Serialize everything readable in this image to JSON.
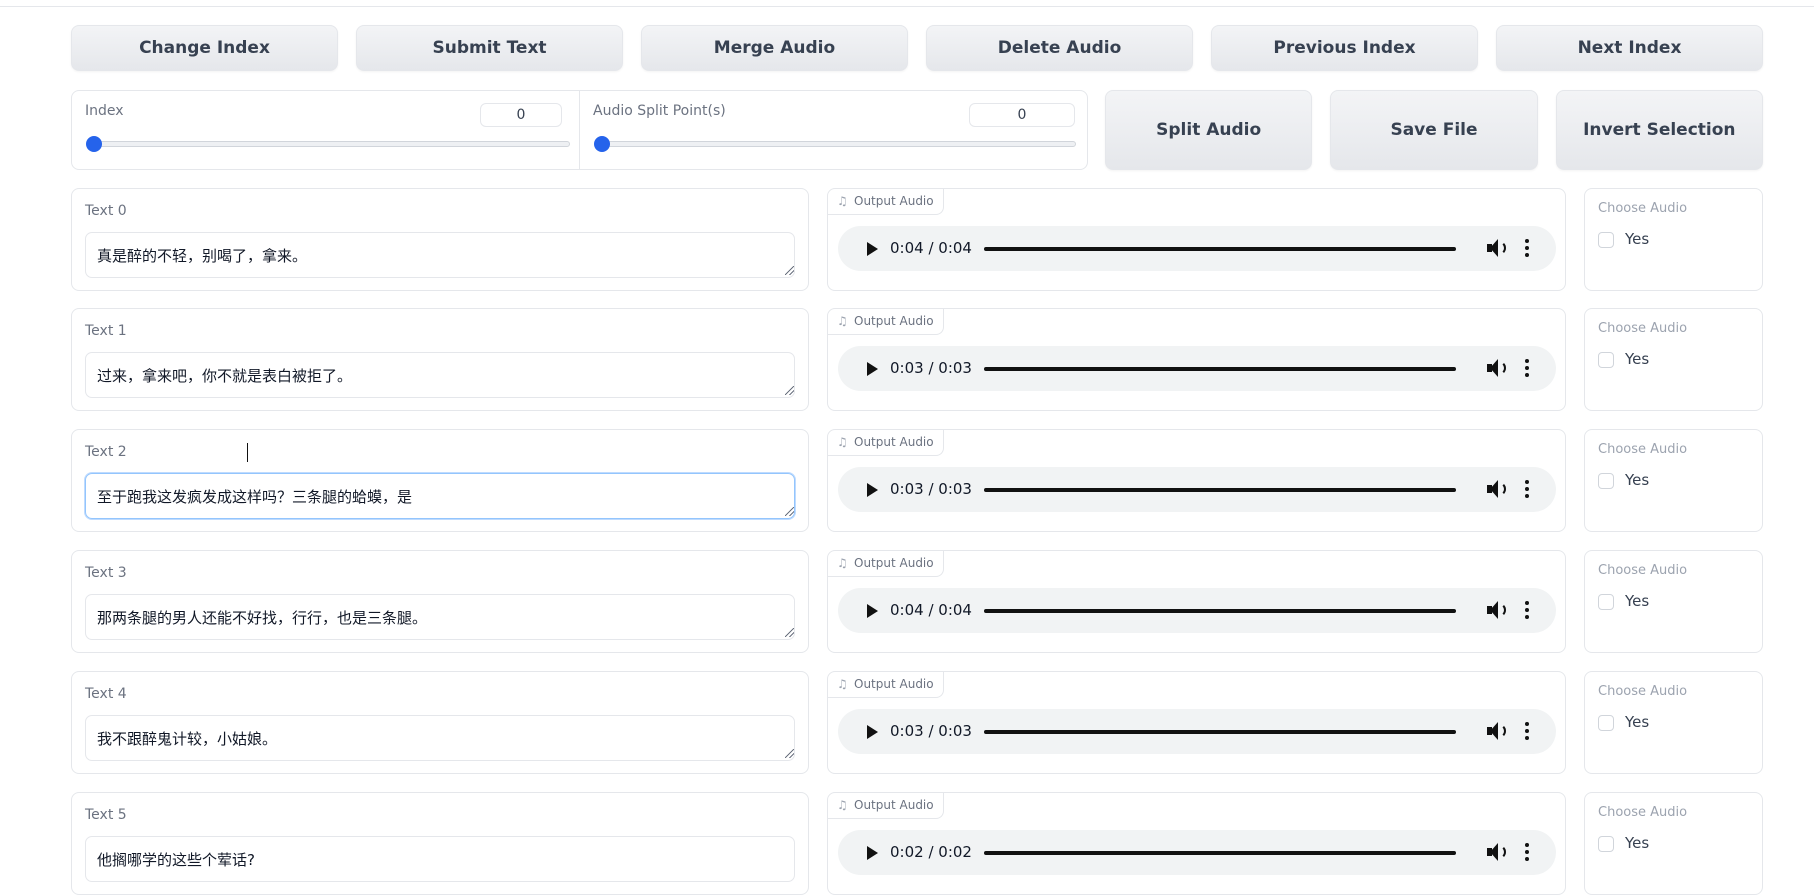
{
  "toolbar": {
    "buttons": [
      "Change Index",
      "Submit Text",
      "Merge Audio",
      "Delete Audio",
      "Previous Index",
      "Next Index"
    ]
  },
  "sliders": {
    "index": {
      "label": "Index",
      "value": "0"
    },
    "split": {
      "label": "Audio Split Point(s)",
      "value": "0"
    }
  },
  "actions": [
    "Split Audio",
    "Save File",
    "Invert Selection"
  ],
  "rows": [
    {
      "label": "Text 0",
      "text": "真是醉的不轻，别喝了，拿来。",
      "audio_label": "Output Audio",
      "time": "0:04 / 0:04",
      "choose_label": "Choose Audio",
      "checkbox_label": "Yes"
    },
    {
      "label": "Text 1",
      "text": "过来，拿来吧，你不就是表白被拒了。",
      "audio_label": "Output Audio",
      "time": "0:03 / 0:03",
      "choose_label": "Choose Audio",
      "checkbox_label": "Yes"
    },
    {
      "label": "Text 2",
      "text": "至于跑我这发疯发成这样吗？三条腿的蛤蟆，是",
      "audio_label": "Output Audio",
      "time": "0:03 / 0:03",
      "choose_label": "Choose Audio",
      "checkbox_label": "Yes"
    },
    {
      "label": "Text 3",
      "text": "那两条腿的男人还能不好找，行行，也是三条腿。",
      "audio_label": "Output Audio",
      "time": "0:04 / 0:04",
      "choose_label": "Choose Audio",
      "checkbox_label": "Yes"
    },
    {
      "label": "Text 4",
      "text": "我不跟醉鬼计较，小姑娘。",
      "audio_label": "Output Audio",
      "time": "0:03 / 0:03",
      "choose_label": "Choose Audio",
      "checkbox_label": "Yes"
    },
    {
      "label": "Text 5",
      "text": "他搁哪学的这些个荤话?",
      "audio_label": "Output Audio",
      "time": "0:02 / 0:02",
      "choose_label": "Choose Audio",
      "checkbox_label": "Yes"
    }
  ],
  "icons": {
    "audio_tag": "music-note-icon",
    "play": "play-icon",
    "volume": "volume-icon",
    "more": "more-vertical-icon"
  },
  "colors": {
    "accent": "#2563eb",
    "focus_border": "#93c5fd"
  }
}
